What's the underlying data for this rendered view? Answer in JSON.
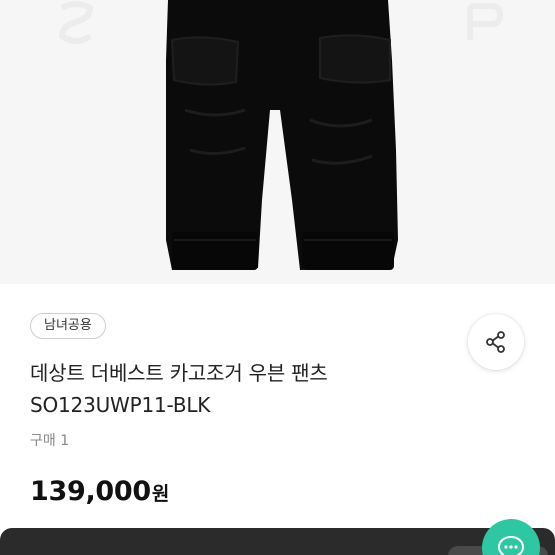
{
  "product": {
    "image_icon": "product-photo",
    "tag": "남녀공용",
    "title": "데상트 더베스트 카고조거 우븐 팬츠 SO123UWP11-BLK",
    "purchase_count": "구매 1",
    "price": "139,000",
    "price_unit": "원"
  },
  "actions": {
    "share_icon": "share-icon",
    "chat_icon": "chat-icon"
  },
  "colors": {
    "accent": "#2fc7a3",
    "bottom_bar": "#2b2b2b"
  }
}
